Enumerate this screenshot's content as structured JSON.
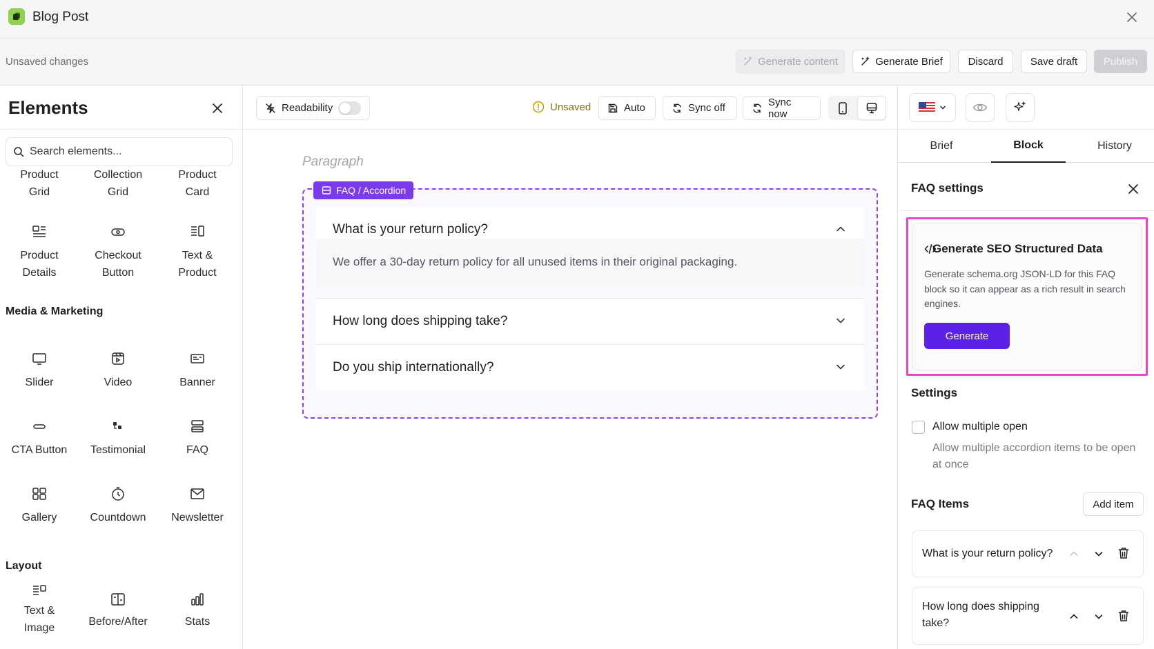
{
  "window": {
    "title": "Blog Post",
    "logo_icon": "app-logo-icon",
    "close_icon": "close-icon"
  },
  "actionbar": {
    "status_text": "Unsaved changes",
    "generate_content_label": "Generate content",
    "generate_brief_label": "Generate Brief",
    "discard_label": "Discard",
    "save_draft_label": "Save draft",
    "publish_label": "Publish"
  },
  "elements_panel": {
    "title": "Elements",
    "search_placeholder": "Search elements...",
    "commerce_items": [
      {
        "label1": "Product",
        "label2": "Grid"
      },
      {
        "label1": "Collection",
        "label2": "Grid"
      },
      {
        "label1": "Product",
        "label2": "Card"
      },
      {
        "label1": "Product",
        "label2": "Details",
        "icon": "product-details-icon"
      },
      {
        "label1": "Checkout",
        "label2": "Button",
        "icon": "checkout-button-icon"
      },
      {
        "label1": "Text &",
        "label2": "Product",
        "icon": "text-product-icon"
      }
    ],
    "media_section_title": "Media & Marketing",
    "media_items": [
      {
        "label": "Slider",
        "icon": "slider-icon"
      },
      {
        "label": "Video",
        "icon": "video-icon"
      },
      {
        "label": "Banner",
        "icon": "banner-icon"
      },
      {
        "label": "CTA Button",
        "icon": "cta-button-icon"
      },
      {
        "label": "Testimonial",
        "icon": "testimonial-icon"
      },
      {
        "label": "FAQ",
        "icon": "faq-icon"
      },
      {
        "label": "Gallery",
        "icon": "gallery-icon"
      },
      {
        "label": "Countdown",
        "icon": "countdown-icon"
      },
      {
        "label": "Newsletter",
        "icon": "newsletter-icon"
      }
    ],
    "layout_section_title": "Layout",
    "layout_items": [
      {
        "label1": "Text &",
        "label2": "Image",
        "icon": "text-image-icon"
      },
      {
        "label": "Before/After",
        "icon": "before-after-icon"
      },
      {
        "label": "Stats",
        "icon": "stats-icon"
      }
    ]
  },
  "editor_toolbar": {
    "readability_label": "Readability",
    "unsaved_label": "Unsaved",
    "auto_label": "Auto",
    "sync_off_label": "Sync off",
    "sync_now_label": "Sync now"
  },
  "canvas": {
    "paragraph_placeholder": "Paragraph",
    "faq_tag_label": "FAQ / Accordion",
    "faq_items": [
      {
        "question": "What is your return policy?",
        "answer": "We offer a 30-day return policy for all unused items in their original packaging.",
        "expanded": true
      },
      {
        "question": "How long does shipping take?",
        "expanded": false
      },
      {
        "question": "Do you ship internationally?",
        "expanded": false
      }
    ]
  },
  "right_panel": {
    "locale_flag": "us-flag-icon",
    "tabs": [
      {
        "label": "Brief",
        "active": false
      },
      {
        "label": "Block",
        "active": true
      },
      {
        "label": "History",
        "active": false
      }
    ],
    "faq_settings_title": "FAQ settings",
    "seo": {
      "title": "Generate SEO Structured Data",
      "description": "Generate schema.org JSON-LD for this FAQ block so it can appear as a rich result in search engines.",
      "button_label": "Generate"
    },
    "settings_title": "Settings",
    "allow_multiple_label": "Allow multiple open",
    "allow_multiple_checked": false,
    "allow_multiple_desc": "Allow multiple accordion items to be open at once",
    "faq_items_title": "FAQ Items",
    "add_item_label": "Add item",
    "items": [
      {
        "text": "What is your return policy?"
      },
      {
        "text": "How long does shipping take?"
      }
    ]
  },
  "colors": {
    "accent": "#7c3aed",
    "generate_button": "#5b21e6",
    "highlight": "#ee44c8",
    "logo": "#8fd14f"
  }
}
